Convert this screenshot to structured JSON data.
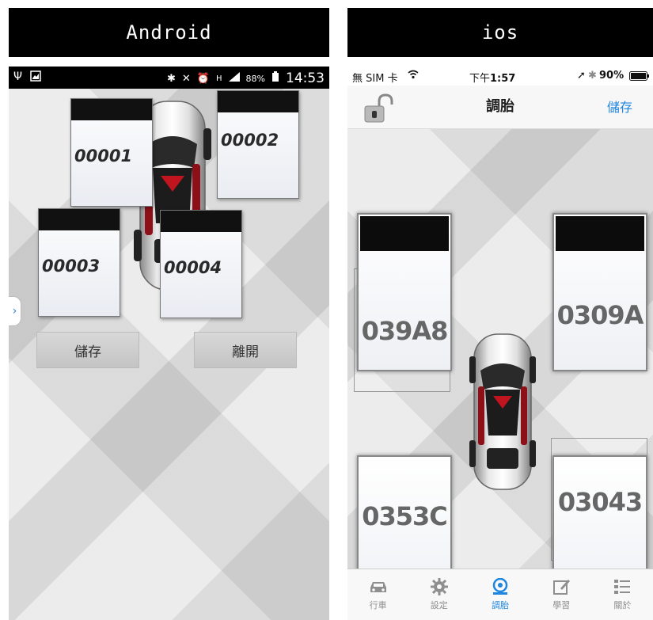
{
  "android": {
    "title": "Android",
    "status": {
      "battery": "88%",
      "time": "14:53"
    },
    "tires": [
      {
        "code": "00001"
      },
      {
        "code": "00002"
      },
      {
        "code": "00003"
      },
      {
        "code": "00004"
      }
    ],
    "buttons": {
      "save": "儲存",
      "exit": "離開"
    },
    "side_tab_glyph": "›"
  },
  "ios": {
    "title": "ios",
    "status": {
      "carrier": "無 SIM 卡",
      "time_prefix": "下午",
      "time": "1:57",
      "battery": "90%"
    },
    "nav": {
      "title": "調胎",
      "save": "儲存"
    },
    "tires": [
      {
        "code": "039A8"
      },
      {
        "code": "0309A"
      },
      {
        "code": "0353C"
      },
      {
        "code": "03043"
      }
    ],
    "tabbar": [
      {
        "label": "行車",
        "icon": "car-icon",
        "active": false
      },
      {
        "label": "設定",
        "icon": "gear-icon",
        "active": false
      },
      {
        "label": "調胎",
        "icon": "tire-icon",
        "active": true
      },
      {
        "label": "學習",
        "icon": "edit-icon",
        "active": false
      },
      {
        "label": "關於",
        "icon": "list-icon",
        "active": false
      }
    ],
    "accent_color": "#1f86e0"
  }
}
